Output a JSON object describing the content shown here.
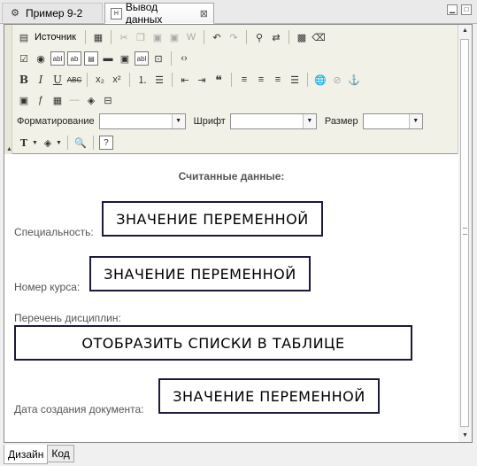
{
  "tabs": [
    {
      "label": "Пример 9-2",
      "icon": "gear-icon"
    },
    {
      "label": "Вывод данных",
      "icon": "html-document-icon"
    }
  ],
  "toolbar": {
    "source_label": "Источник",
    "format_label": "Форматирование",
    "font_label": "Шрифт",
    "size_label": "Размер",
    "format_value": "",
    "font_value": "",
    "size_value": ""
  },
  "document": {
    "heading": "Считанные данные:",
    "specialty_label": "Специальность:",
    "course_label": "Номер курса:",
    "disciplines_label": "Перечень дисциплин:",
    "date_label": "Дата создания документа:",
    "var1": "ЗНАЧЕНИЕ ПЕРЕМЕННОЙ",
    "var2": "ЗНАЧЕНИЕ ПЕРЕМЕННОЙ",
    "table_action": "ОТОБРАЗИТЬ СПИСКИ В ТАБЛИЦЕ",
    "var3": "ЗНАЧЕНИЕ ПЕРЕМЕННОЙ"
  },
  "bottom_tabs": [
    "Дизайн",
    "Код"
  ]
}
